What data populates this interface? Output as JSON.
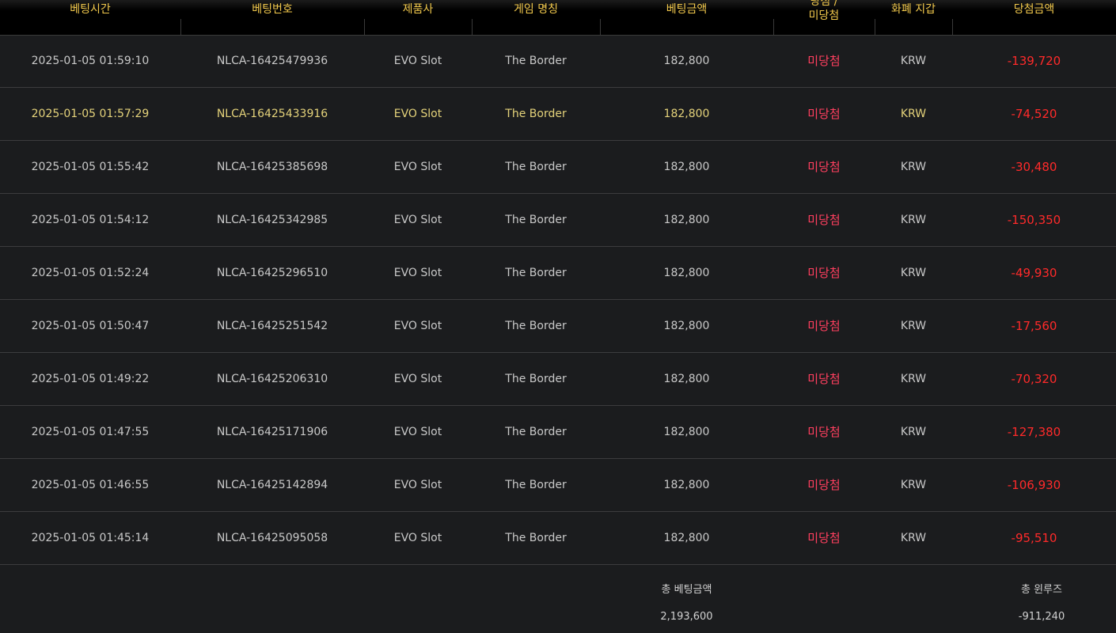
{
  "header": {
    "columns": [
      {
        "label": "베팅시간"
      },
      {
        "label": "베팅번호"
      },
      {
        "label": "제품사"
      },
      {
        "label": "게임 명칭"
      },
      {
        "label": "베팅금액"
      },
      {
        "label": "당첨 / 미당첨"
      },
      {
        "label": "화폐 지갑"
      },
      {
        "label": "당첨금액"
      }
    ],
    "status_col_line1": "당첨 /",
    "status_col_line2": "미당첨"
  },
  "rows": [
    {
      "time": "2025-01-05 01:59:10",
      "bet_id": "NLCA-16425479936",
      "provider": "EVO Slot",
      "game": "The Border",
      "amount": "182,800",
      "status": "미당첨",
      "wallet": "KRW",
      "win": "-139,720"
    },
    {
      "time": "2025-01-05 01:57:29",
      "bet_id": "NLCA-16425433916",
      "provider": "EVO Slot",
      "game": "The Border",
      "amount": "182,800",
      "status": "미당첨",
      "wallet": "KRW",
      "win": "-74,520"
    },
    {
      "time": "2025-01-05 01:55:42",
      "bet_id": "NLCA-16425385698",
      "provider": "EVO Slot",
      "game": "The Border",
      "amount": "182,800",
      "status": "미당첨",
      "wallet": "KRW",
      "win": "-30,480"
    },
    {
      "time": "2025-01-05 01:54:12",
      "bet_id": "NLCA-16425342985",
      "provider": "EVO Slot",
      "game": "The Border",
      "amount": "182,800",
      "status": "미당첨",
      "wallet": "KRW",
      "win": "-150,350"
    },
    {
      "time": "2025-01-05 01:52:24",
      "bet_id": "NLCA-16425296510",
      "provider": "EVO Slot",
      "game": "The Border",
      "amount": "182,800",
      "status": "미당첨",
      "wallet": "KRW",
      "win": "-49,930"
    },
    {
      "time": "2025-01-05 01:50:47",
      "bet_id": "NLCA-16425251542",
      "provider": "EVO Slot",
      "game": "The Border",
      "amount": "182,800",
      "status": "미당첨",
      "wallet": "KRW",
      "win": "-17,560"
    },
    {
      "time": "2025-01-05 01:49:22",
      "bet_id": "NLCA-16425206310",
      "provider": "EVO Slot",
      "game": "The Border",
      "amount": "182,800",
      "status": "미당첨",
      "wallet": "KRW",
      "win": "-70,320"
    },
    {
      "time": "2025-01-05 01:47:55",
      "bet_id": "NLCA-16425171906",
      "provider": "EVO Slot",
      "game": "The Border",
      "amount": "182,800",
      "status": "미당첨",
      "wallet": "KRW",
      "win": "-127,380"
    },
    {
      "time": "2025-01-05 01:46:55",
      "bet_id": "NLCA-16425142894",
      "provider": "EVO Slot",
      "game": "The Border",
      "amount": "182,800",
      "status": "미당첨",
      "wallet": "KRW",
      "win": "-106,930"
    },
    {
      "time": "2025-01-05 01:45:14",
      "bet_id": "NLCA-16425095058",
      "provider": "EVO Slot",
      "game": "The Border",
      "amount": "182,800",
      "status": "미당첨",
      "wallet": "KRW",
      "win": "-95,510"
    }
  ],
  "summary": {
    "total_bet_label": "총 베팅금액",
    "total_bet_value": "2,193,600",
    "total_winloss_label": "총 윈루즈",
    "total_winloss_value": "-911,240"
  },
  "colors": {
    "background": "#1b1c1e",
    "header_text": "#f2c94c",
    "row_text": "#c9c9c9",
    "highlight_row_text": "#e4d27a",
    "status_red": "#ff3f5f",
    "win_red": "#ff2a2a"
  }
}
